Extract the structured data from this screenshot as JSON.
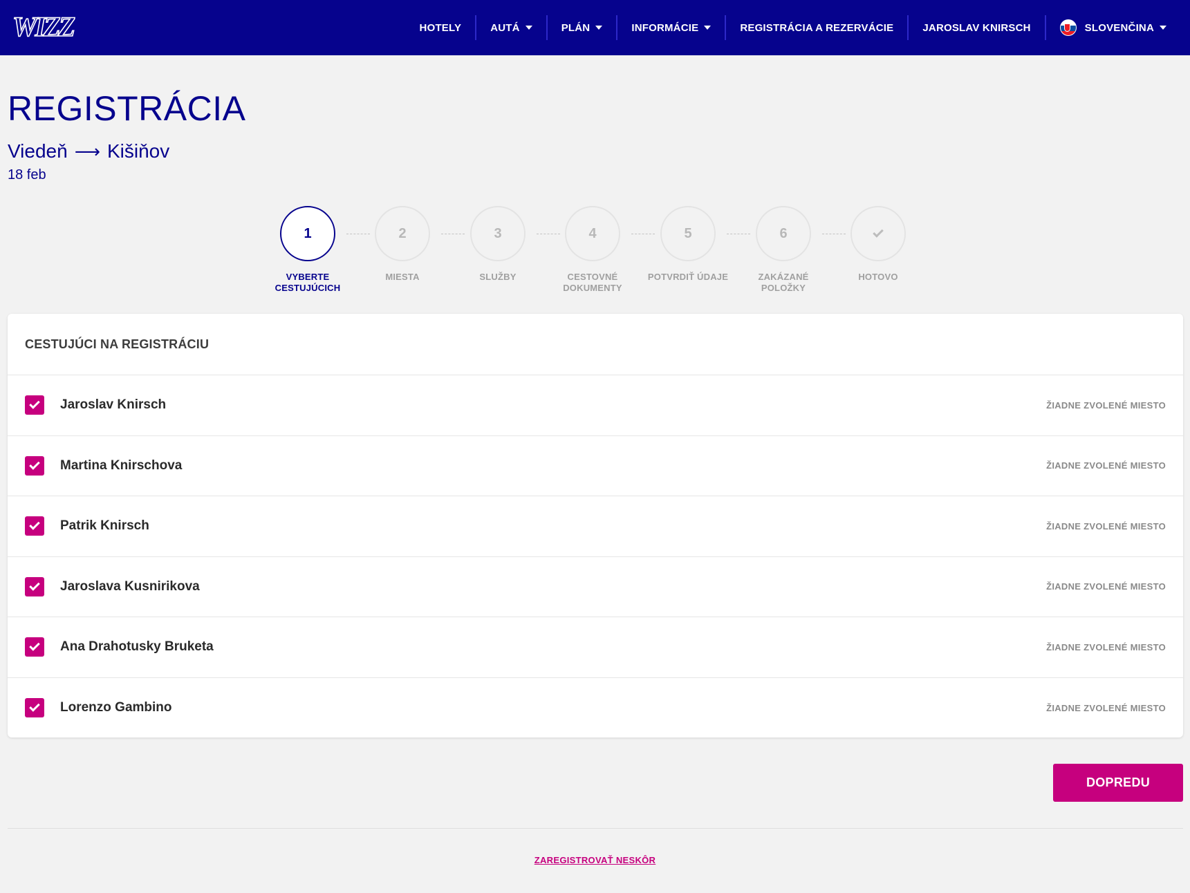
{
  "header": {
    "logo_text": "WIZZ",
    "nav": [
      {
        "label": "HOTELY",
        "dropdown": false
      },
      {
        "label": "AUTÁ",
        "dropdown": true
      },
      {
        "label": "PLÁN",
        "dropdown": true
      },
      {
        "label": "INFORMÁCIE",
        "dropdown": true
      },
      {
        "label": "REGISTRÁCIA A REZERVÁCIE",
        "dropdown": false
      },
      {
        "label": "JAROSLAV KNIRSCH",
        "dropdown": false
      },
      {
        "label": "SLOVENČINA",
        "dropdown": true
      }
    ]
  },
  "page": {
    "title": "REGISTRÁCIA",
    "route_from": "Viedeň",
    "route_arrow": "⟶",
    "route_to": "Kišiňov",
    "date": "18 feb"
  },
  "stepper": {
    "steps": [
      {
        "num": "1",
        "label": "VYBERTE CESTUJÚCICH",
        "active": true
      },
      {
        "num": "2",
        "label": "MIESTA",
        "active": false
      },
      {
        "num": "3",
        "label": "SLUŽBY",
        "active": false
      },
      {
        "num": "4",
        "label": "CESTOVNÉ DOKUMENTY",
        "active": false
      },
      {
        "num": "5",
        "label": "POTVRDIŤ ÚDAJE",
        "active": false
      },
      {
        "num": "6",
        "label": "ZAKÁZANÉ POLOŽKY",
        "active": false
      },
      {
        "num": "",
        "label": "HOTOVO",
        "active": false,
        "icon": "check-icon"
      }
    ]
  },
  "passengers": {
    "heading": "CESTUJÚCI NA REGISTRÁCIU",
    "items": [
      {
        "name": "Jaroslav Knirsch",
        "checked": true,
        "seat": "ŽIADNE ZVOLENÉ MIESTO"
      },
      {
        "name": "Martina Knirschova",
        "checked": true,
        "seat": "ŽIADNE ZVOLENÉ MIESTO"
      },
      {
        "name": "Patrik Knirsch",
        "checked": true,
        "seat": "ŽIADNE ZVOLENÉ MIESTO"
      },
      {
        "name": "Jaroslava Kusnirikova",
        "checked": true,
        "seat": "ŽIADNE ZVOLENÉ MIESTO"
      },
      {
        "name": "Ana Drahotusky Bruketa",
        "checked": true,
        "seat": "ŽIADNE ZVOLENÉ MIESTO"
      },
      {
        "name": "Lorenzo Gambino",
        "checked": true,
        "seat": "ŽIADNE ZVOLENÉ MIESTO"
      }
    ]
  },
  "actions": {
    "next_label": "DOPREDU",
    "later_label": "ZAREGISTROVAŤ NESKÔR"
  },
  "colors": {
    "brand_navy": "#06038d",
    "accent_magenta": "#c6007e",
    "background": "#f2f2f2"
  }
}
